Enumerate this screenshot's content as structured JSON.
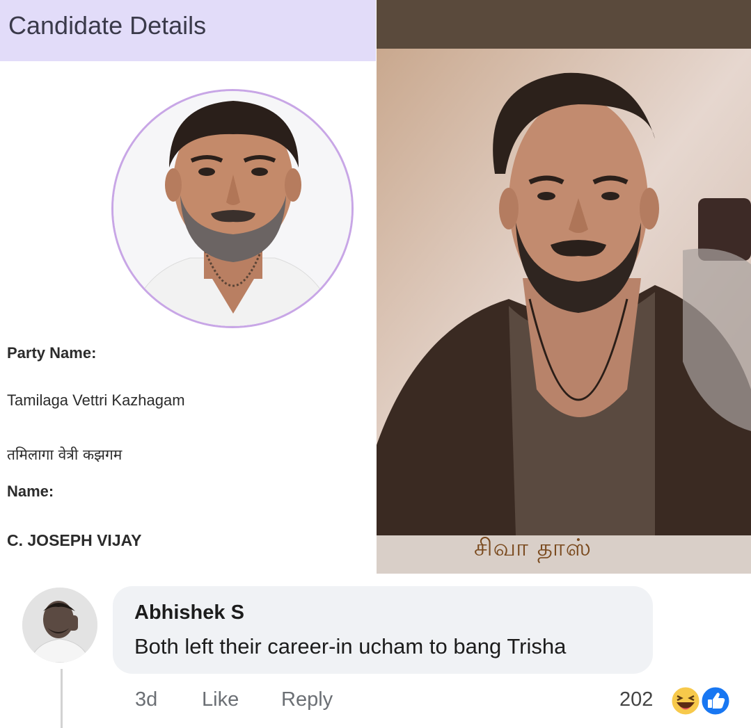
{
  "candidate_card": {
    "title": "Candidate Details",
    "party_label": "Party Name:",
    "party_name_en": "Tamilaga Vettri Kazhagam",
    "party_name_hi": "तमिलागा वेत्री कझगम",
    "name_label": "Name:",
    "name_value": "C. JOSEPH VIJAY",
    "header_color": "#e2dcf9",
    "ring_color": "#c8a6e6"
  },
  "poster": {
    "caption": "சிவா தாஸ்"
  },
  "comment": {
    "author": "Abhishek S",
    "text": "Both left their career-in ucham to bang Trisha",
    "time": "3d",
    "like_label": "Like",
    "reply_label": "Reply",
    "reaction_count": "202",
    "reaction_icons": [
      "haha-emoji-icon",
      "like-thumb-icon"
    ],
    "bubble_color": "#f0f2f5",
    "like_color": "#1877f2"
  }
}
